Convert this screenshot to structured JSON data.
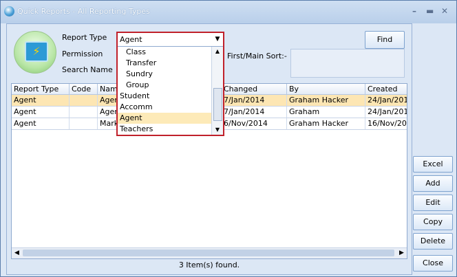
{
  "window": {
    "title": "Quick Reports - All Reporting Types"
  },
  "form": {
    "report_type_label": "Report Type",
    "report_type_value": "Agent",
    "permission_label": "Permission",
    "search_name_label": "Search Name",
    "first_sort_label": "First/Main Sort:-",
    "find_label": "Find"
  },
  "grid": {
    "headers": [
      "Report Type",
      "Code",
      "Name",
      "Changed",
      "By",
      "Created"
    ],
    "rows": [
      [
        "Agent",
        "",
        "Agent",
        "7/Jan/2014",
        "Graham Hacker",
        "24/Jan/201"
      ],
      [
        "Agent",
        "",
        "Agent",
        "7/Jan/2014",
        "Graham",
        "24/Jan/201"
      ],
      [
        "Agent",
        "",
        "Marke",
        "6/Nov/2014",
        "Graham Hacker",
        "16/Nov/201"
      ]
    ]
  },
  "status": {
    "text": "3 Item(s) found."
  },
  "buttons": {
    "excel": "Excel",
    "add": "Add",
    "edit": "Edit",
    "copy": "Copy",
    "delete": "Delete",
    "close": "Close"
  },
  "dropdown": {
    "current_value": "Agent",
    "options": [
      "Class",
      "Transfer",
      "Sundry",
      "Group",
      "Student",
      "Accomm",
      "Agent",
      "Teachers"
    ],
    "selected": "Agent"
  },
  "colors": {
    "selection": "#fde6b3",
    "dropdown_border": "#c0202a",
    "window_bg": "#dce7f5"
  },
  "icons": [
    "app-icon",
    "minimize-icon",
    "maximize-icon",
    "close-icon",
    "chevron-down-icon",
    "scroll-left-icon",
    "scroll-right-icon",
    "scroll-up-icon",
    "scroll-down-icon",
    "quick-reports-logo-icon"
  ]
}
